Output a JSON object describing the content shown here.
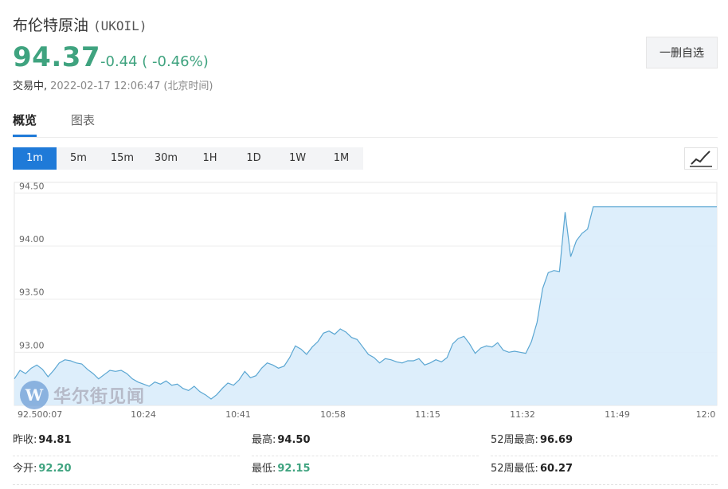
{
  "header": {
    "name": "布伦特原油",
    "code": "(UKOIL)",
    "price": "94.37",
    "change": "-0.44 ( -0.46%)",
    "status": "交易中,",
    "timestamp": "2022-02-17 12:06:47 (北京时间)",
    "watch_button": "一删自选"
  },
  "tabs": [
    {
      "label": "概览",
      "active": true
    },
    {
      "label": "图表",
      "active": false
    }
  ],
  "periods": [
    {
      "label": "1m",
      "active": true
    },
    {
      "label": "5m"
    },
    {
      "label": "15m"
    },
    {
      "label": "30m"
    },
    {
      "label": "1H"
    },
    {
      "label": "1D"
    },
    {
      "label": "1W"
    },
    {
      "label": "1M"
    }
  ],
  "chart_toggle_icon": "line-chart-icon",
  "watermark": {
    "logo_letter": "W",
    "text": "华尔街见闻"
  },
  "chart_data": {
    "type": "area",
    "ylim": [
      92.5,
      94.6
    ],
    "y_ticks": [
      94.5,
      94.0,
      93.5,
      93.0
    ],
    "y_tick_labels": [
      "94.50",
      "94.00",
      "93.50",
      "93.00"
    ],
    "x_tick_labels": [
      "92.500:07",
      "10:24",
      "10:41",
      "10:58",
      "11:15",
      "11:32",
      "11:49",
      "12:0"
    ],
    "x_range_minutes": [
      0,
      125
    ],
    "series": [
      {
        "x": [
          0,
          1,
          2,
          3,
          4,
          5,
          6,
          7,
          8,
          9,
          10,
          11,
          12,
          13,
          14,
          15,
          16,
          17,
          18,
          19,
          20,
          21,
          22,
          23,
          24,
          25,
          26,
          27,
          28,
          29,
          30,
          31,
          32,
          33,
          34,
          35,
          36,
          37,
          38,
          39,
          40,
          41,
          42,
          43,
          44,
          45,
          46,
          47,
          48,
          49,
          50,
          51,
          52,
          53,
          54,
          55,
          56,
          57,
          58,
          59,
          60,
          61,
          62,
          63,
          64,
          65,
          66,
          67,
          68,
          69,
          70,
          71,
          72,
          73,
          74,
          75,
          76,
          77,
          78,
          79,
          80,
          81,
          82,
          83,
          84,
          85,
          86,
          87,
          88,
          89,
          90,
          91,
          92,
          93,
          94,
          95,
          96,
          97,
          98,
          99,
          100,
          101,
          102,
          103,
          104,
          105,
          106,
          107,
          108,
          109,
          110,
          111,
          112,
          113,
          114,
          115,
          116,
          117,
          118,
          119,
          120,
          121,
          122,
          123,
          124,
          125
        ],
        "values": [
          92.75,
          92.83,
          92.8,
          92.85,
          92.88,
          92.84,
          92.77,
          92.83,
          92.9,
          92.93,
          92.92,
          92.9,
          92.89,
          92.84,
          92.8,
          92.75,
          92.79,
          92.83,
          92.82,
          92.83,
          92.8,
          92.75,
          92.72,
          92.7,
          92.68,
          92.72,
          92.7,
          92.73,
          92.69,
          92.7,
          92.66,
          92.64,
          92.68,
          92.63,
          92.6,
          92.56,
          92.6,
          92.66,
          92.71,
          92.69,
          92.74,
          92.82,
          92.76,
          92.78,
          92.85,
          92.9,
          92.88,
          92.85,
          92.87,
          92.95,
          93.06,
          93.03,
          92.98,
          93.05,
          93.1,
          93.18,
          93.2,
          93.17,
          93.22,
          93.19,
          93.14,
          93.12,
          93.05,
          92.98,
          92.95,
          92.9,
          92.94,
          92.93,
          92.91,
          92.9,
          92.92,
          92.92,
          92.94,
          92.88,
          92.9,
          92.93,
          92.91,
          92.95,
          93.08,
          93.13,
          93.15,
          93.08,
          92.99,
          93.04,
          93.06,
          93.05,
          93.09,
          93.02,
          93.0,
          93.01,
          93.0,
          92.99,
          93.1,
          93.28,
          93.6,
          93.75,
          93.77,
          93.76,
          94.32,
          93.9,
          94.05,
          94.12,
          94.16,
          94.37,
          94.37,
          94.37,
          94.37,
          94.37,
          94.37,
          94.37,
          94.37,
          94.37,
          94.37,
          94.37,
          94.37,
          94.37,
          94.37,
          94.37,
          94.37,
          94.37,
          94.37,
          94.37,
          94.37,
          94.37,
          94.37,
          94.37
        ]
      }
    ],
    "grid": true,
    "colors": {
      "line": "#5aa6d2",
      "fill": "#d9ecfb",
      "grid": "#ececec"
    }
  },
  "stats": [
    {
      "label": "昨收:",
      "value": "94.81",
      "green": false
    },
    {
      "label": "最高:",
      "value": "94.50",
      "green": false
    },
    {
      "label": "52周最高:",
      "value": "96.69",
      "green": false
    },
    {
      "label": "今开:",
      "value": "92.20",
      "green": true
    },
    {
      "label": "最低:",
      "value": "92.15",
      "green": true
    },
    {
      "label": "52周最低:",
      "value": "60.27",
      "green": false
    }
  ]
}
